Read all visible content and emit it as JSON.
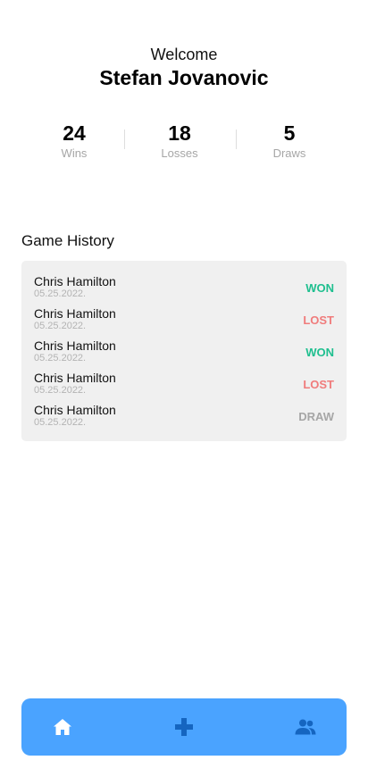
{
  "header": {
    "welcome_label": "Welcome",
    "user_name": "Stefan Jovanovic"
  },
  "stats": {
    "wins": {
      "value": "24",
      "label": "Wins"
    },
    "losses": {
      "value": "18",
      "label": "Losses"
    },
    "draws": {
      "value": "5",
      "label": "Draws"
    }
  },
  "history": {
    "title": "Game History",
    "games": [
      {
        "opponent": "Chris Hamilton",
        "date": "05.25.2022.",
        "result": "WON"
      },
      {
        "opponent": "Chris Hamilton",
        "date": "05.25.2022.",
        "result": "LOST"
      },
      {
        "opponent": "Chris Hamilton",
        "date": "05.25.2022.",
        "result": "WON"
      },
      {
        "opponent": "Chris Hamilton",
        "date": "05.25.2022.",
        "result": "LOST"
      },
      {
        "opponent": "Chris Hamilton",
        "date": "05.25.2022.",
        "result": "DRAW"
      }
    ]
  },
  "tabbar": {
    "tabs": [
      {
        "icon": "home-icon",
        "active": true
      },
      {
        "icon": "gamepad-icon",
        "active": false
      },
      {
        "icon": "friends-icon",
        "active": false
      }
    ]
  },
  "colors": {
    "won": "#1fbf8f",
    "lost": "#f07c7c",
    "draw": "#a6a6a6",
    "tabbar": "#4aa3ff",
    "icon_active": "#ffffff",
    "icon_inactive": "#1565c0"
  }
}
